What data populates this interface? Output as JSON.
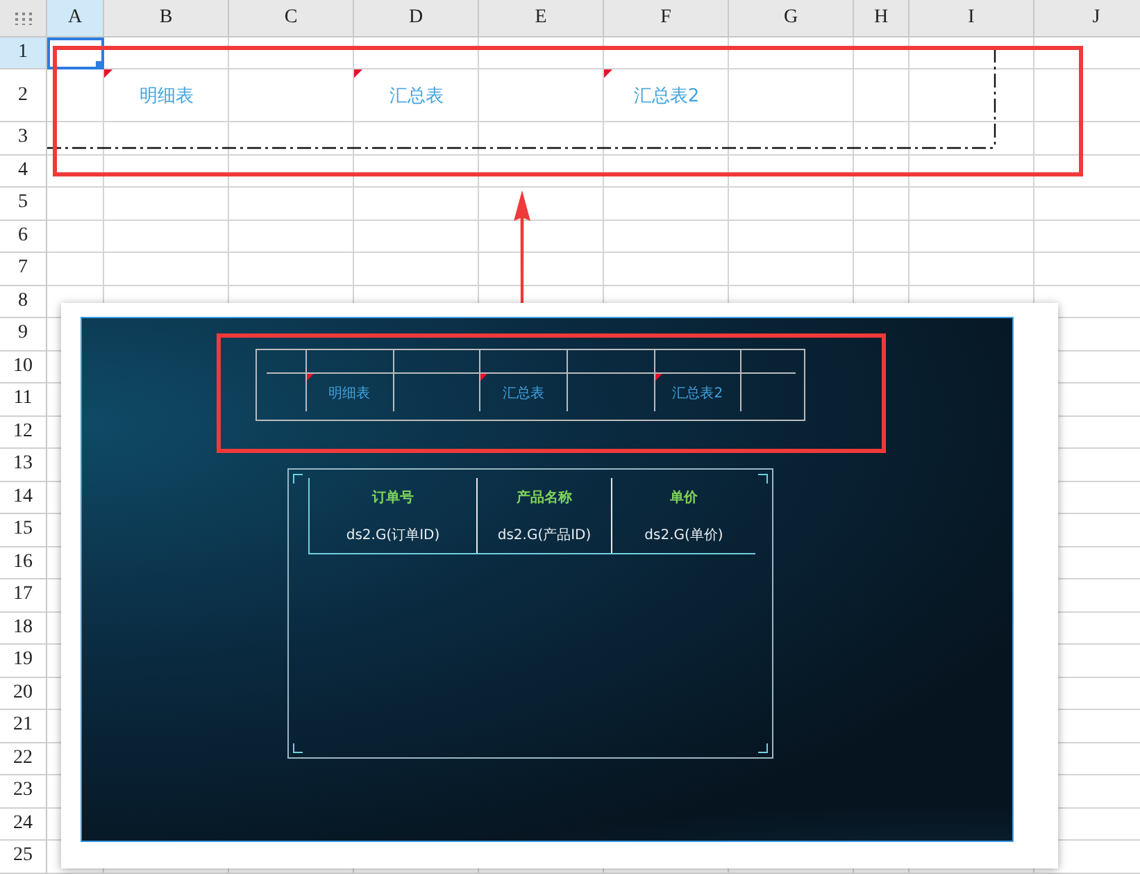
{
  "columns": [
    {
      "label": "A",
      "selected": true
    },
    {
      "label": "B",
      "selected": false
    },
    {
      "label": "C",
      "selected": false
    },
    {
      "label": "D",
      "selected": false
    },
    {
      "label": "E",
      "selected": false
    },
    {
      "label": "F",
      "selected": false
    },
    {
      "label": "G",
      "selected": false
    },
    {
      "label": "H",
      "selected": false
    },
    {
      "label": "I",
      "selected": false
    },
    {
      "label": "J",
      "selected": false
    }
  ],
  "rows": [
    {
      "label": "1",
      "selected": true
    },
    {
      "label": "2",
      "selected": false
    },
    {
      "label": "3",
      "selected": false
    },
    {
      "label": "4",
      "selected": false
    },
    {
      "label": "5",
      "selected": false
    },
    {
      "label": "6",
      "selected": false
    },
    {
      "label": "7",
      "selected": false
    },
    {
      "label": "8",
      "selected": false
    },
    {
      "label": "9",
      "selected": false
    },
    {
      "label": "10",
      "selected": false
    },
    {
      "label": "11",
      "selected": false
    },
    {
      "label": "12",
      "selected": false
    },
    {
      "label": "13",
      "selected": false
    },
    {
      "label": "14",
      "selected": false
    },
    {
      "label": "15",
      "selected": false
    },
    {
      "label": "16",
      "selected": false
    },
    {
      "label": "17",
      "selected": false
    },
    {
      "label": "18",
      "selected": false
    },
    {
      "label": "19",
      "selected": false
    },
    {
      "label": "20",
      "selected": false
    },
    {
      "label": "21",
      "selected": false
    },
    {
      "label": "22",
      "selected": false
    },
    {
      "label": "23",
      "selected": false
    },
    {
      "label": "24",
      "selected": false
    },
    {
      "label": "25",
      "selected": false
    }
  ],
  "sheet_cells": [
    {
      "text": "明细表",
      "flagged": true
    },
    {
      "text": "汇总表",
      "flagged": true
    },
    {
      "text": "汇总表2",
      "flagged": true
    }
  ],
  "preview": {
    "links": [
      {
        "text": "明细表",
        "flagged": true
      },
      {
        "text": "汇总表",
        "flagged": true
      },
      {
        "text": "汇总表2",
        "flagged": true
      }
    ],
    "table": {
      "columns": [
        "订单号",
        "产品名称",
        "单价"
      ],
      "row": [
        "ds2.G(订单ID)",
        "ds2.G(产品ID)",
        "ds2.G(单价)"
      ]
    }
  }
}
